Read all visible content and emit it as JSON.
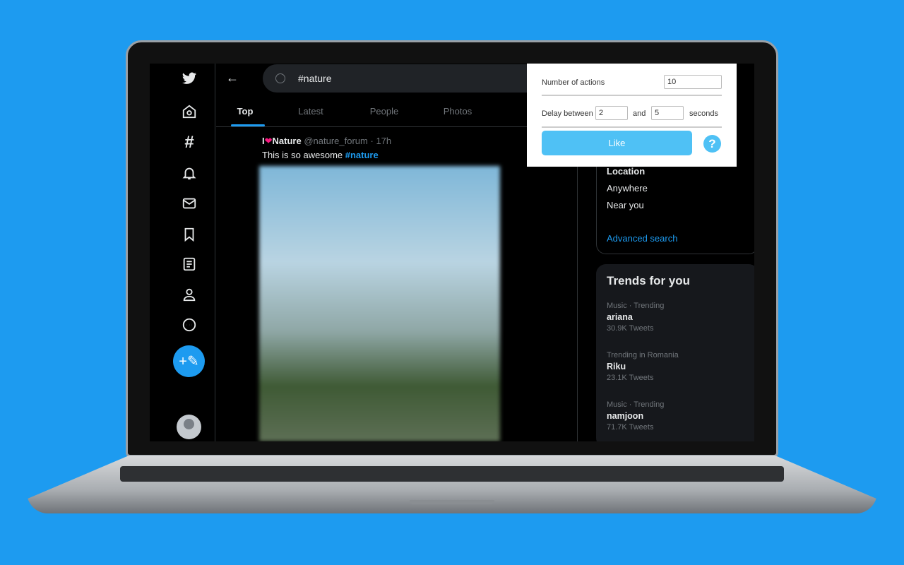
{
  "colors": {
    "background": "#1d9bf0",
    "accent": "#1d9bf0",
    "like_button": "#4fc1f5"
  },
  "sidebar": {
    "icons": [
      "twitter-logo",
      "home",
      "explore-hashtag",
      "notifications-bell",
      "messages-mail",
      "bookmarks",
      "lists",
      "profile",
      "more",
      "compose-tweet",
      "avatar"
    ]
  },
  "search": {
    "value": "#nature"
  },
  "tabs": [
    {
      "label": "Top",
      "active": true
    },
    {
      "label": "Latest"
    },
    {
      "label": "People"
    },
    {
      "label": "Photos"
    }
  ],
  "tweet": {
    "name_prefix": "I",
    "name_heart": "❤",
    "name": "Nature",
    "handle": "@nature_forum",
    "time": "· 17h",
    "text": "This is so awesome ",
    "hashtag": "#nature"
  },
  "filters": {
    "location_title": "Location",
    "options": [
      "Anywhere",
      "Near you"
    ],
    "advanced": "Advanced search"
  },
  "trends": {
    "title": "Trends for you",
    "items": [
      {
        "meta": "Music · Trending",
        "name": "ariana",
        "count": "30.9K Tweets"
      },
      {
        "meta": "Trending in Romania",
        "name": "Riku",
        "count": "23.1K Tweets"
      },
      {
        "meta": "Music · Trending",
        "name": "namjoon",
        "count": "71.7K Tweets"
      }
    ]
  },
  "popup": {
    "actions_label": "Number of actions",
    "actions_value": "10",
    "delay_label": "Delay between",
    "delay_min": "2",
    "and_label": "and",
    "delay_max": "5",
    "seconds_label": "seconds",
    "like_label": "Like",
    "help": "?"
  }
}
